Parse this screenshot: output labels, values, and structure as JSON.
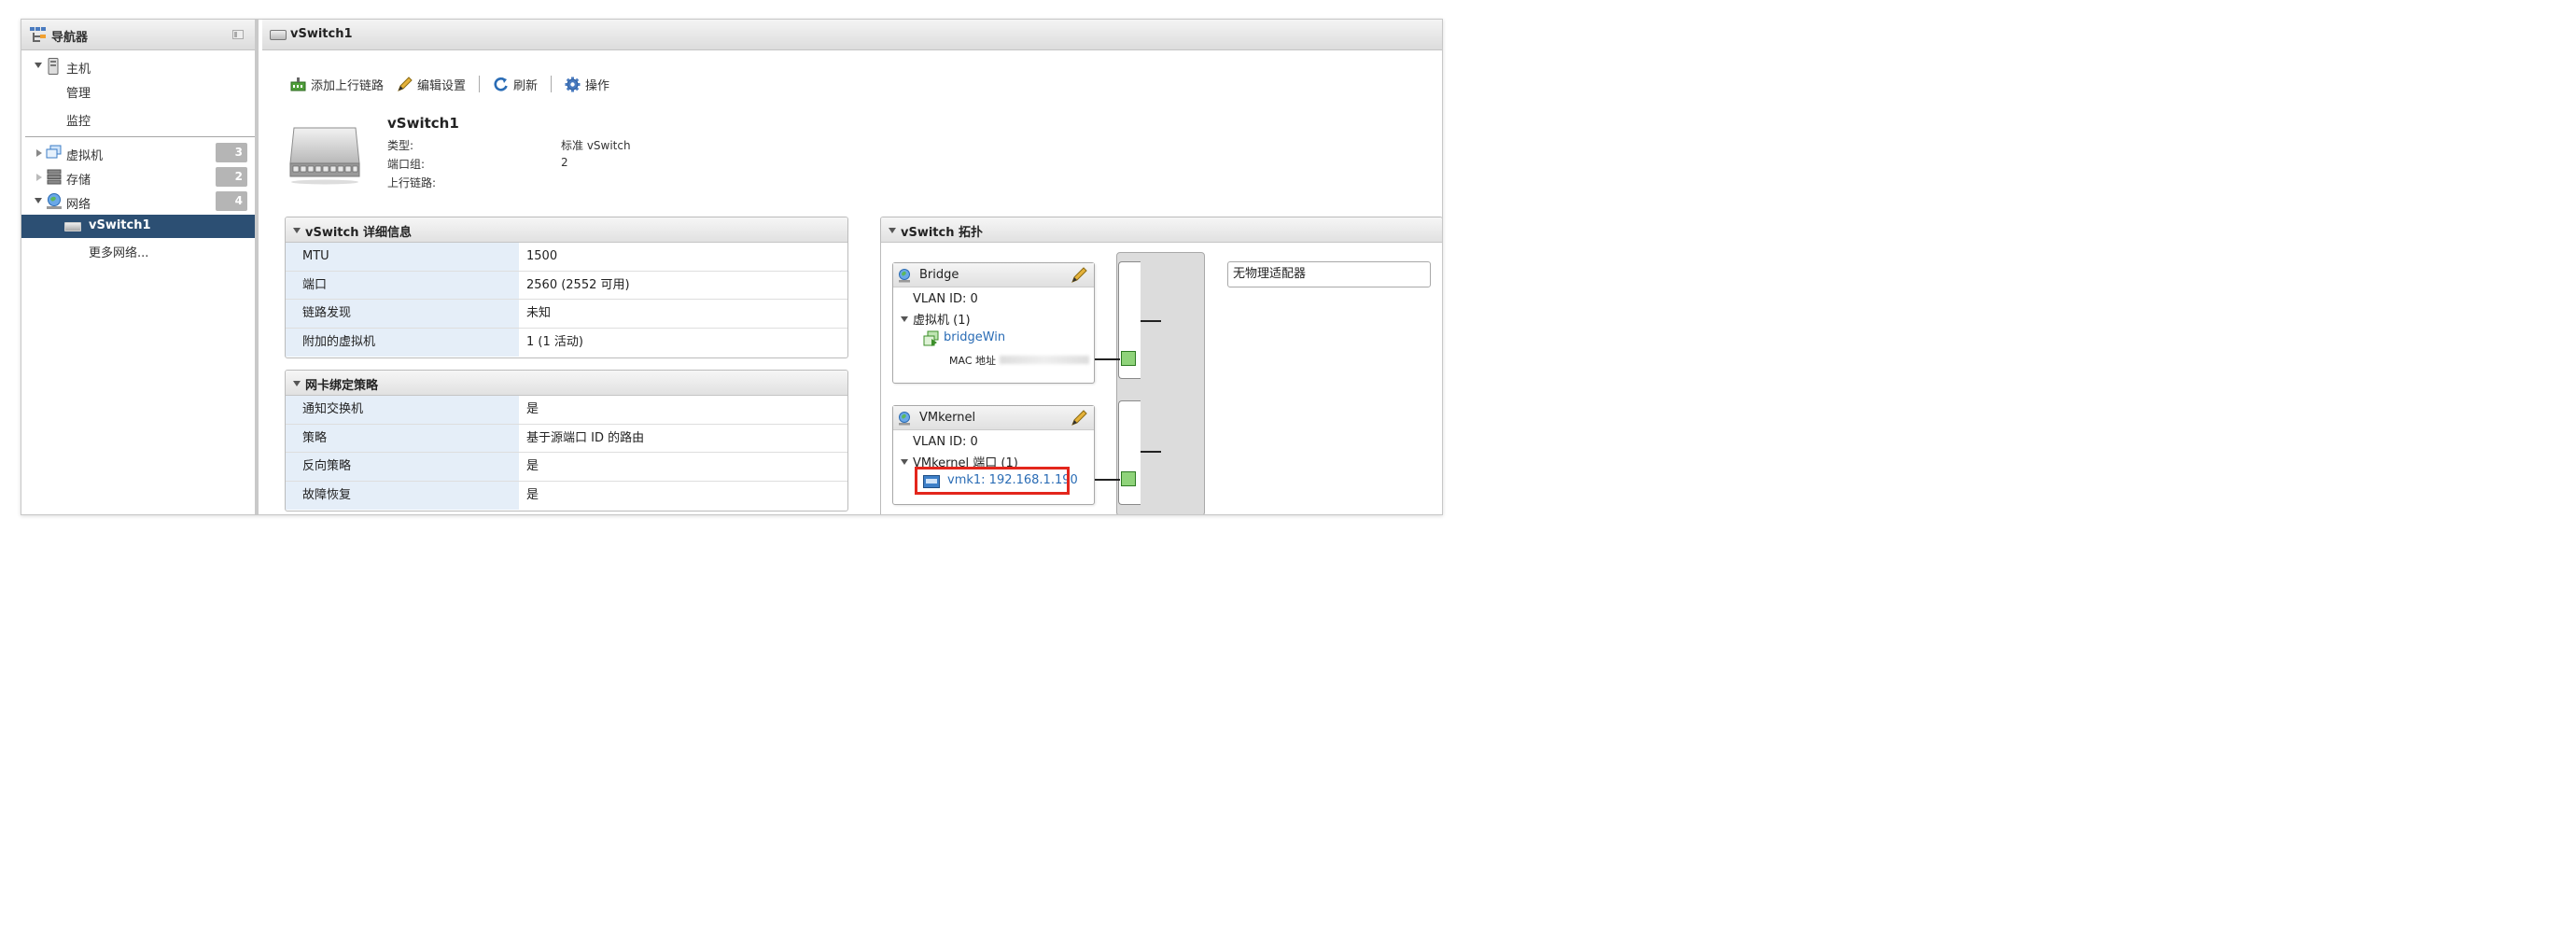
{
  "navigator": {
    "title": "导航器",
    "host": {
      "label": "主机",
      "children": [
        "管理",
        "监控"
      ]
    },
    "vms": {
      "label": "虚拟机",
      "count": "3"
    },
    "storage": {
      "label": "存储",
      "count": "2"
    },
    "network": {
      "label": "网络",
      "count": "4"
    },
    "vswitch_item": "vSwitch1",
    "more_networks": "更多网络..."
  },
  "main": {
    "title": "vSwitch1",
    "toolbar": {
      "add_uplink": "添加上行链路",
      "edit_settings": "编辑设置",
      "refresh": "刷新",
      "actions": "操作"
    },
    "summary": {
      "name": "vSwitch1",
      "type_label": "类型:",
      "type_value": "标准 vSwitch",
      "portgroups_label": "端口组:",
      "portgroups_value": "2",
      "uplinks_label": "上行链路:"
    },
    "details": {
      "title": "vSwitch 详细信息",
      "rows": [
        {
          "k": "MTU",
          "v": "1500"
        },
        {
          "k": "端口",
          "v": "2560 (2552 可用)"
        },
        {
          "k": "链路发现",
          "v": "未知"
        },
        {
          "k": "附加的虚拟机",
          "v": "1 (1 活动)"
        }
      ]
    },
    "teaming": {
      "title": "网卡绑定策略",
      "rows": [
        {
          "k": "通知交换机",
          "v": "是"
        },
        {
          "k": "策略",
          "v": "基于源端口 ID 的路由"
        },
        {
          "k": "反向策略",
          "v": "是"
        },
        {
          "k": "故障恢复",
          "v": "是"
        }
      ]
    },
    "topology": {
      "title": "vSwitch 拓扑",
      "bridge": {
        "name": "Bridge",
        "vlan": "VLAN ID: 0",
        "vms": "虚拟机 (1)",
        "vm_name": "bridgeWin",
        "mac_label": "MAC 地址"
      },
      "vmkernel": {
        "name": "VMkernel",
        "vlan": "VLAN ID: 0",
        "ports": "VMkernel 端口 (1)",
        "vmk": "vmk1: 192.168.1.190"
      },
      "no_adapter": "无物理适配器"
    }
  },
  "colors": {
    "selected_bg": "#2c4f73",
    "link": "#2a6cb5",
    "highlight": "#e3261c",
    "port_green": "#8fd37a"
  }
}
